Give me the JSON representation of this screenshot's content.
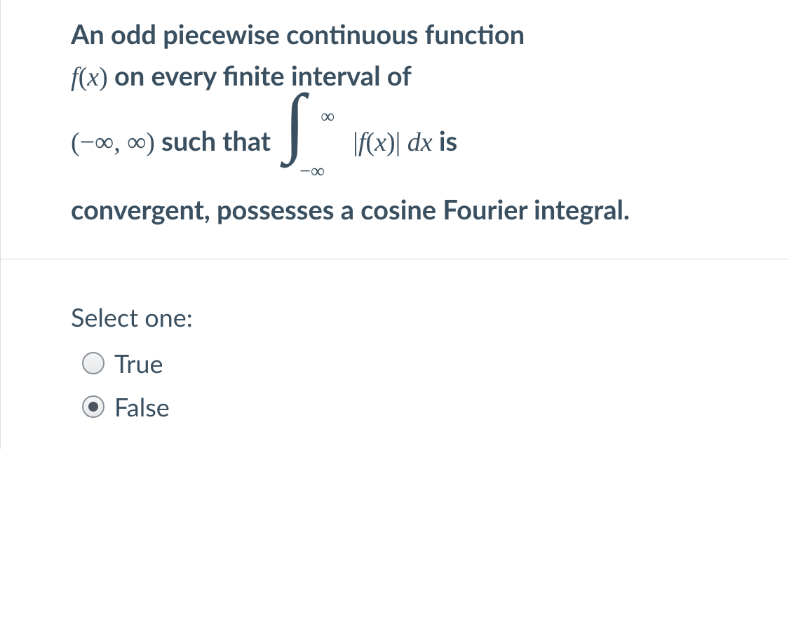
{
  "question": {
    "part1": "An odd piecewise continuous function ",
    "fx": "f",
    "fx_paren_open": "(",
    "fx_var": "x",
    "fx_paren_close": ")",
    "part2": " on every finite interval of",
    "interval_open": "(−",
    "infinity1": "∞",
    "interval_comma": ", ",
    "infinity2": "∞",
    "interval_close": ")",
    "such_that": " such that ",
    "int_upper": "∞",
    "int_lower": "−∞",
    "abs_open": "|",
    "int_f": "f",
    "int_paren_open": "(",
    "int_var": "x",
    "int_paren_close": ")",
    "abs_close": "|",
    "dx_d": " d",
    "dx_x": "x",
    "is": " is",
    "part3": "convergent, possesses a cosine Fourier integral."
  },
  "answer": {
    "prompt": "Select one:",
    "option_true": "True",
    "option_false": "False",
    "selected": "false"
  }
}
